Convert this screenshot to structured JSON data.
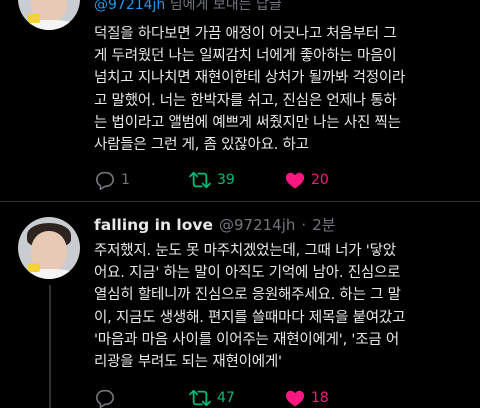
{
  "tweet1": {
    "reply_prefix": "@97214jh",
    "reply_suffix": " 님에게 보내는 답글",
    "text": "덕질을 하다보면 가끔 애정이 어긋나고 처음부터 그\n게 두려웠던 나는 일찌감치 너에게 좋아하는 마음이\n넘치고 지나치면 재현이한테 상처가 될까봐 걱정이라\n고 말했어. 너는 한박자를 쉬고, 진심은 언제나 통하\n는 법이라고 앨범에 예쁘게 써줬지만 나는 사진 찍는\n사람들은 그런 게, 좀 있잖아요. 하고",
    "stats": {
      "replies": "1",
      "retweets": "39",
      "likes": "20"
    }
  },
  "tweet2": {
    "display_name": "falling in love",
    "handle": "@97214jh",
    "separator": "·",
    "time": "2분",
    "text": "주저했지. 눈도 못 마주치겠었는데, 그때 너가 '닿았\n어요. 지금' 하는 말이 아직도 기억에 남아. 진심으로\n열심히 할테니까 진심으로 응원해주세요. 하는 그 말\n이, 지금도 생생해. 편지를 쓸때마다 제목을 붙여갔고\n'마음과 마음 사이를 이어주는 재현이에게', '조금 어\n리광을 부려도 되는 재현이에게'",
    "stats": {
      "retweets": "47",
      "likes": "18"
    }
  },
  "icons": {
    "reply": "reply-bubble-icon",
    "retweet": "retweet-icon",
    "like": "heart-icon"
  },
  "colors": {
    "background": "#000000",
    "text": "#e7e9ea",
    "muted": "#71767b",
    "link": "#1d9bf0",
    "retweet": "#00ba7c",
    "like": "#f91880"
  }
}
